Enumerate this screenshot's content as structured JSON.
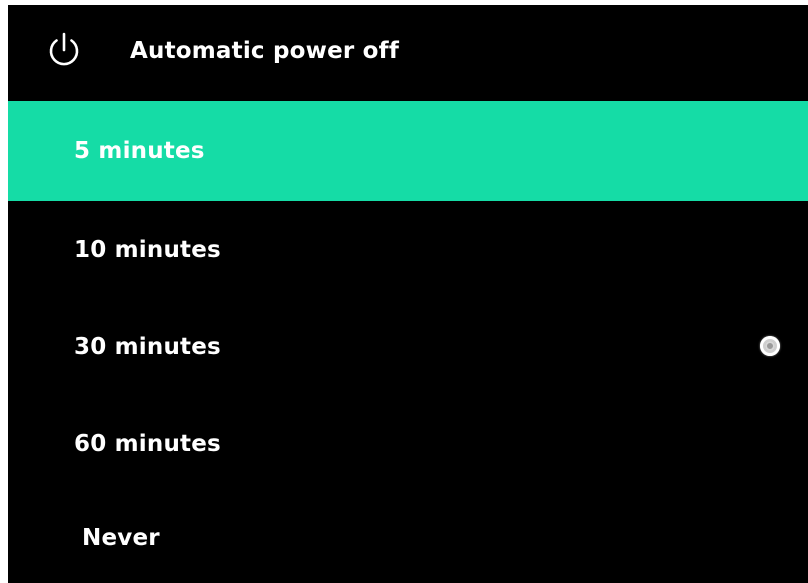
{
  "header": {
    "title": "Automatic power off",
    "icon": "power-icon"
  },
  "options": [
    {
      "label": "5 minutes",
      "highlighted": true,
      "checked": false
    },
    {
      "label": "10 minutes",
      "highlighted": false,
      "checked": false
    },
    {
      "label": "30 minutes",
      "highlighted": false,
      "checked": true
    },
    {
      "label": "60 minutes",
      "highlighted": false,
      "checked": false
    },
    {
      "label": "Never",
      "highlighted": false,
      "checked": false
    }
  ],
  "colors": {
    "background": "#000000",
    "highlight": "#15dca6",
    "text": "#ffffff"
  }
}
